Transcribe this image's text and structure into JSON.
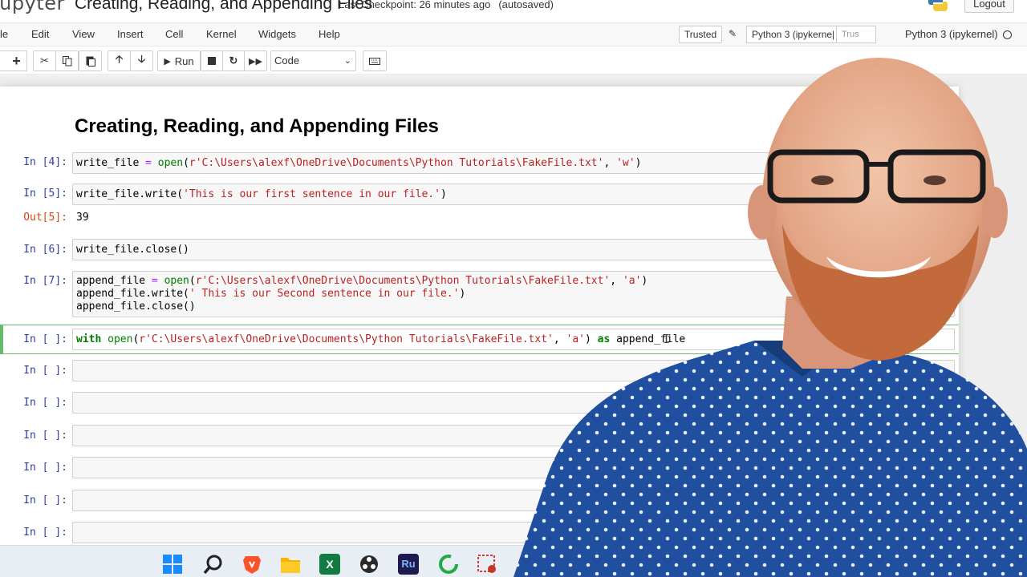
{
  "header": {
    "logo_text": "jupyter",
    "notebook_title": "Creating, Reading, and Appending Files",
    "checkpoint": "Last Checkpoint: 26 minutes ago",
    "autosaved": "(autosaved)",
    "logout_label": "Logout"
  },
  "menubar": {
    "items": [
      "le",
      "Edit",
      "View",
      "Insert",
      "Cell",
      "Kernel",
      "Widgets",
      "Help"
    ],
    "trusted_label": "Trusted",
    "kernel_name_box": "Python 3 (ipykerne|",
    "trusted_badge": "Trus",
    "kernel_name": "Python 3 (ipykernel)"
  },
  "toolbar": {
    "run_label": "Run",
    "cell_type": "Code"
  },
  "notebook": {
    "heading": "Creating, Reading, and Appending Files",
    "cells": [
      {
        "prompt": "In [4]:",
        "lines": [
          "write_file = open(r'C:\\Users\\alexf\\OneDrive\\Documents\\Python Tutorials\\FakeFile.txt', 'w')"
        ]
      },
      {
        "prompt": "In [5]:",
        "lines": [
          "write_file.write('This is our first sentence in our file.')"
        ],
        "out_prompt": "Out[5]:",
        "output": "39"
      },
      {
        "prompt": "In [6]:",
        "lines": [
          "write_file.close()"
        ]
      },
      {
        "prompt": "In [7]:",
        "lines": [
          "append_file = open(r'C:\\Users\\alexf\\OneDrive\\Documents\\Python Tutorials\\FakeFile.txt', 'a')",
          "append_file.write(' This is our Second sentence in our file.')",
          "append_file.close()"
        ]
      },
      {
        "prompt": "In [ ]:",
        "lines": [
          "with open(r'C:\\Users\\alexf\\OneDrive\\Documents\\Python Tutorials\\FakeFile.txt', 'a') as append_file"
        ]
      },
      {
        "prompt": "In [ ]:",
        "lines": []
      },
      {
        "prompt": "In [ ]:",
        "lines": []
      },
      {
        "prompt": "In [ ]:",
        "lines": []
      },
      {
        "prompt": "In [ ]:",
        "lines": []
      },
      {
        "prompt": "In [ ]:",
        "lines": []
      },
      {
        "prompt": "In [ ]:",
        "lines": []
      }
    ]
  },
  "taskbar": {
    "icons": [
      "windows-start-icon",
      "search-icon",
      "brave-browser-icon",
      "file-explorer-icon",
      "excel-icon",
      "obs-icon",
      "rush-icon",
      "loading-circle-icon",
      "snipping-tool-icon"
    ],
    "excel_letter": "X",
    "rush_letters": "Ru"
  },
  "colors": {
    "prompt_in": "#303f9f",
    "prompt_out": "#d84315",
    "string": "#ba2121",
    "keyword": "#008000",
    "active_cell": "#66bb6a",
    "shirt": "#1f4f9e"
  }
}
